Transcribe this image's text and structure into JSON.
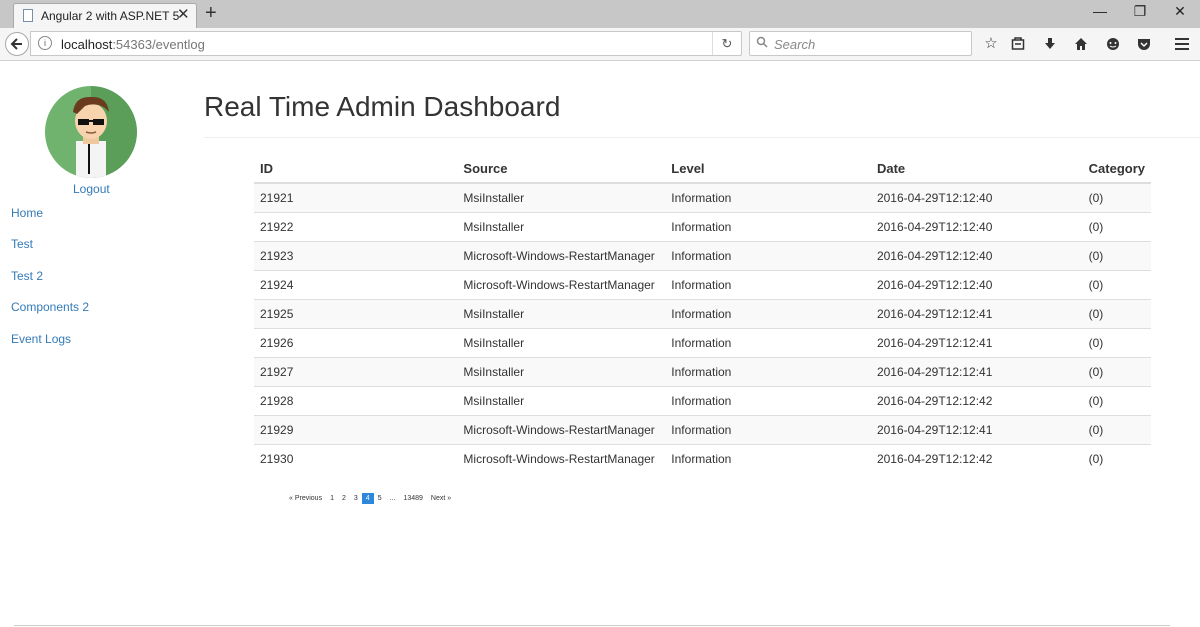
{
  "browser": {
    "tab_title": "Angular 2 with ASP.NET 5",
    "tab_close": "✕",
    "new_tab": "+",
    "url_host": "localhost",
    "url_path": ":54363/eventlog",
    "search_placeholder": "Search",
    "window_controls": {
      "minimize": "—",
      "restore": "❐",
      "close": "✕"
    },
    "toolbar_icons": [
      "bookmark-star-icon",
      "reading-list-icon",
      "download-icon",
      "home-icon",
      "chat-icon",
      "pocket-icon",
      "menu-icon"
    ]
  },
  "sidebar": {
    "logout": "Logout",
    "items": [
      {
        "label": "Home"
      },
      {
        "label": "Test"
      },
      {
        "label": "Test 2"
      },
      {
        "label": "Components 2"
      },
      {
        "label": "Event Logs"
      }
    ]
  },
  "page": {
    "title": "Real Time Admin Dashboard"
  },
  "table": {
    "headers": [
      "ID",
      "Source",
      "Level",
      "Date",
      "Category"
    ],
    "rows": [
      [
        "21921",
        "MsiInstaller",
        "Information",
        "2016-04-29T12:12:40",
        "(0)"
      ],
      [
        "21922",
        "MsiInstaller",
        "Information",
        "2016-04-29T12:12:40",
        "(0)"
      ],
      [
        "21923",
        "Microsoft-Windows-RestartManager",
        "Information",
        "2016-04-29T12:12:40",
        "(0)"
      ],
      [
        "21924",
        "Microsoft-Windows-RestartManager",
        "Information",
        "2016-04-29T12:12:40",
        "(0)"
      ],
      [
        "21925",
        "MsiInstaller",
        "Information",
        "2016-04-29T12:12:41",
        "(0)"
      ],
      [
        "21926",
        "MsiInstaller",
        "Information",
        "2016-04-29T12:12:41",
        "(0)"
      ],
      [
        "21927",
        "MsiInstaller",
        "Information",
        "2016-04-29T12:12:41",
        "(0)"
      ],
      [
        "21928",
        "MsiInstaller",
        "Information",
        "2016-04-29T12:12:42",
        "(0)"
      ],
      [
        "21929",
        "Microsoft-Windows-RestartManager",
        "Information",
        "2016-04-29T12:12:41",
        "(0)"
      ],
      [
        "21930",
        "Microsoft-Windows-RestartManager",
        "Information",
        "2016-04-29T12:12:42",
        "(0)"
      ]
    ]
  },
  "pagination": {
    "previous": "« Previous",
    "pages": [
      "1",
      "2",
      "3",
      "4",
      "5",
      "...",
      "13489"
    ],
    "active": "4",
    "next": "Next »"
  },
  "colors": {
    "link": "#337ab7",
    "active_page": "#2e87d8",
    "avatar_bg": "#6fb36f"
  }
}
